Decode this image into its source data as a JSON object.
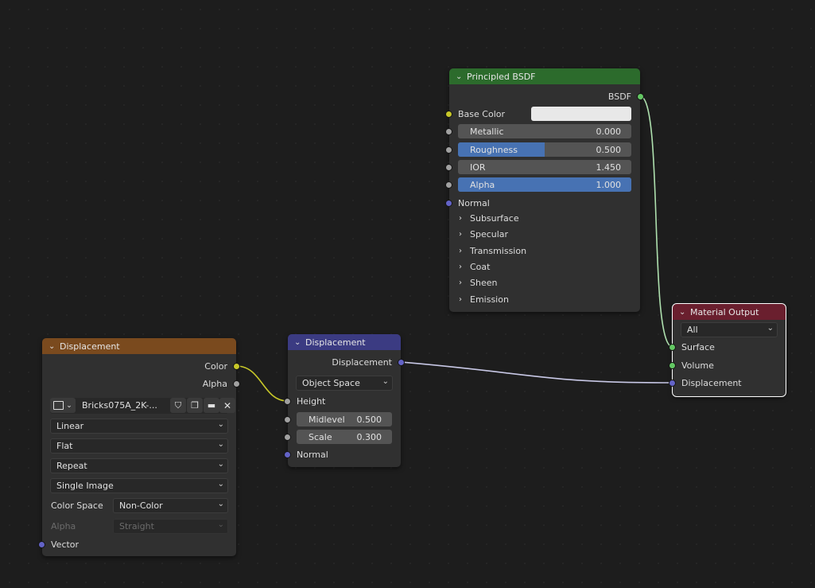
{
  "image_texture": {
    "title": "Displacement",
    "header_color": "#7a4a1e",
    "outputs": [
      "Color",
      "Alpha"
    ],
    "image_name": "Bricks075A_2K-...",
    "interpolation": "Linear",
    "projection": "Flat",
    "extension": "Repeat",
    "source": "Single Image",
    "color_space_label": "Color Space",
    "color_space": "Non-Color",
    "alpha_label": "Alpha",
    "alpha_mode": "Straight",
    "vector_label": "Vector"
  },
  "displacement": {
    "title": "Displacement",
    "header_color": "#3b3b82",
    "output": "Displacement",
    "space": "Object Space",
    "height_label": "Height",
    "midlevel_label": "Midlevel",
    "midlevel_value": "0.500",
    "scale_label": "Scale",
    "scale_value": "0.300",
    "normal_label": "Normal"
  },
  "principled": {
    "title": "Principled BSDF",
    "header_color": "#2c6b2c",
    "output": "BSDF",
    "base_color_label": "Base Color",
    "base_color": "#e8e8e8",
    "metallic_label": "Metallic",
    "metallic_value": "0.000",
    "metallic_fraction": 0,
    "roughness_label": "Roughness",
    "roughness_value": "0.500",
    "roughness_fraction": 0.5,
    "ior_label": "IOR",
    "ior_value": "1.450",
    "alpha_label": "Alpha",
    "alpha_value": "1.000",
    "alpha_fraction": 1,
    "normal_label": "Normal",
    "panels": [
      "Subsurface",
      "Specular",
      "Transmission",
      "Coat",
      "Sheen",
      "Emission"
    ]
  },
  "material_output": {
    "title": "Material Output",
    "header_color": "#6a1f2e",
    "target": "All",
    "inputs": [
      "Surface",
      "Volume",
      "Displacement"
    ]
  }
}
